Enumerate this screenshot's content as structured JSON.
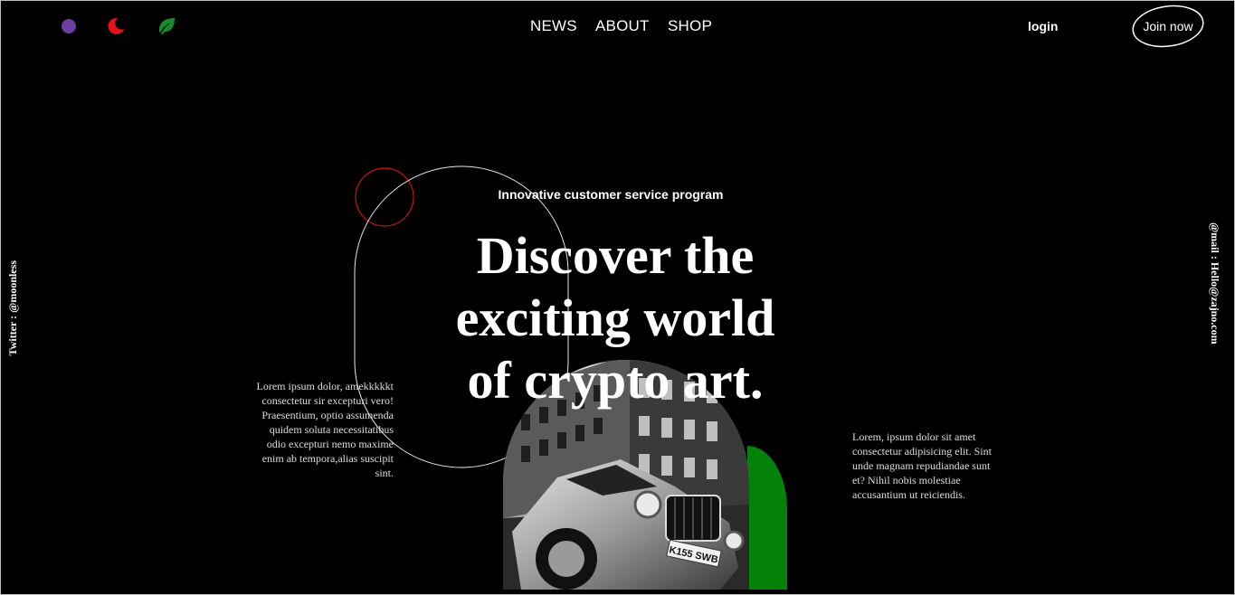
{
  "header": {
    "theme_buttons": [
      {
        "name": "purple-theme-dot",
        "icon": "circle-icon",
        "color": "#6a3fa0"
      },
      {
        "name": "red-theme-moon",
        "icon": "crescent-moon-icon",
        "color": "#e3131b"
      },
      {
        "name": "green-theme-leaf",
        "icon": "leaf-icon",
        "color": "#1a8a2a"
      }
    ],
    "nav": {
      "news": "NEWS",
      "about": "ABOUT",
      "shop": "SHOP"
    },
    "login": "login",
    "join": "Join now"
  },
  "side": {
    "left": "Twitter : @moonless",
    "right": "@mail : Hello@zajno.com"
  },
  "hero": {
    "kicker": "Innovative customer service program",
    "headline": [
      "Discover the",
      "exciting world",
      "of crypto art."
    ],
    "left_text": "Lorem ipsum dolor, amekkkkkt consectetur sir excepturi vero! Praesentium, optio assumenda quidem soluta necessitatibus odio excepturi nemo maxime enim ab tempora,alias suscipit sint.",
    "right_text": "Lorem, ipsum dolor sit amet consectetur adipisicing elit. Sint unde magnam repudiandae sunt et? Nihil nobis molestiae accusantium ut reiciendis.",
    "image_plate": "K155 SWB"
  },
  "colors": {
    "background": "#000000",
    "accent_green": "#058208",
    "accent_red": "#d01818",
    "accent_purple": "#6a3fa0",
    "text": "#ffffff"
  }
}
